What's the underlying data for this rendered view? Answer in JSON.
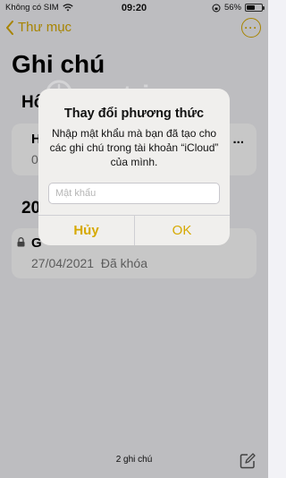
{
  "status_bar": {
    "carrier": "Không có SIM",
    "time": "09:20",
    "battery": "56%",
    "battery_level": 0.56
  },
  "nav": {
    "back_label": "Thư mục"
  },
  "page": {
    "title": "Ghi chú"
  },
  "sections": [
    {
      "header": "Hô"
    },
    {
      "header": "20"
    }
  ],
  "notes": [
    {
      "title": "H",
      "subtitle": "0",
      "trailing": "..."
    },
    {
      "title": "G",
      "date": "27/04/2021",
      "status": "Đã khóa"
    }
  ],
  "footer": {
    "count": "2 ghi chú"
  },
  "watermark": {
    "text": "uantrimang"
  },
  "dialog": {
    "title": "Thay đổi phương thức",
    "message": "Nhập mật khẩu mà bạn đã tạo cho các ghi chú trong tài khoản “iCloud” của mình.",
    "password_placeholder": "Mật khẩu",
    "cancel_label": "Hủy",
    "ok_label": "OK"
  },
  "colors": {
    "accent": "#d6a900",
    "background": "#f2f2f6"
  }
}
